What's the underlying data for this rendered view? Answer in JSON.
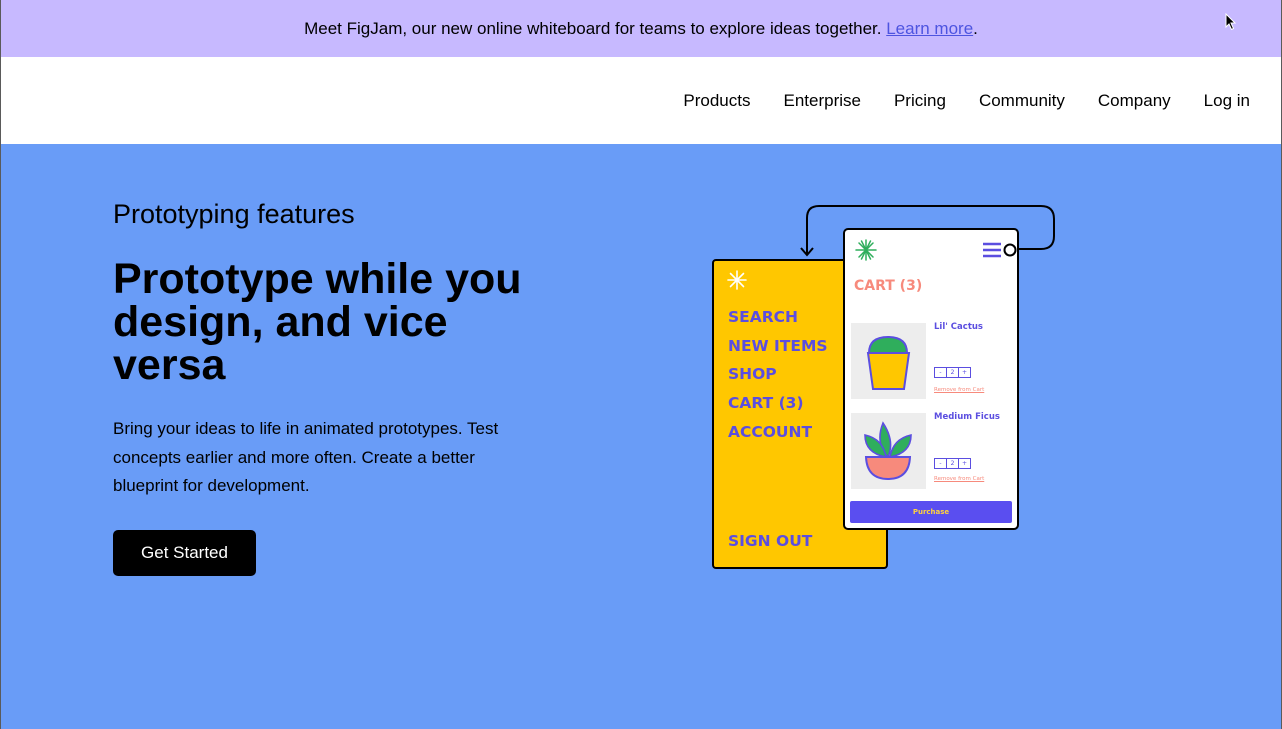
{
  "banner": {
    "text": "Meet FigJam, our new online whiteboard for teams to explore ideas together. ",
    "link_label": "Learn more",
    "suffix": "."
  },
  "nav": {
    "products": "Products",
    "enterprise": "Enterprise",
    "pricing": "Pricing",
    "community": "Community",
    "company": "Company",
    "login": "Log in"
  },
  "hero": {
    "eyebrow": "Prototyping features",
    "headline": "Prototype while you design, and vice versa",
    "description": "Bring your ideas to life in animated prototypes. Test concepts earlier and more often. Create a better blueprint for development.",
    "cta": "Get Started"
  },
  "illustration": {
    "menu": {
      "search": "SEARCH",
      "new_items": "NEW ITEMS",
      "shop": "SHOP",
      "cart": "CART (3)",
      "account": "ACCOUNT",
      "sign_out": "SIGN OUT"
    },
    "cart": {
      "title": "CART (3)",
      "item1_name": "Lil' Cactus",
      "item2_name": "Medium Ficus",
      "qty_minus": "-",
      "qty_value": "2",
      "qty_plus": "+",
      "remove": "Remove from Cart",
      "purchase": "Purchase"
    }
  },
  "colors": {
    "banner_bg": "#c7b9ff",
    "hero_bg": "#699cf7",
    "accent_purple": "#5b4ee0",
    "yellow": "#ffc700",
    "coral": "#f78a7c",
    "green": "#2fae5c"
  }
}
